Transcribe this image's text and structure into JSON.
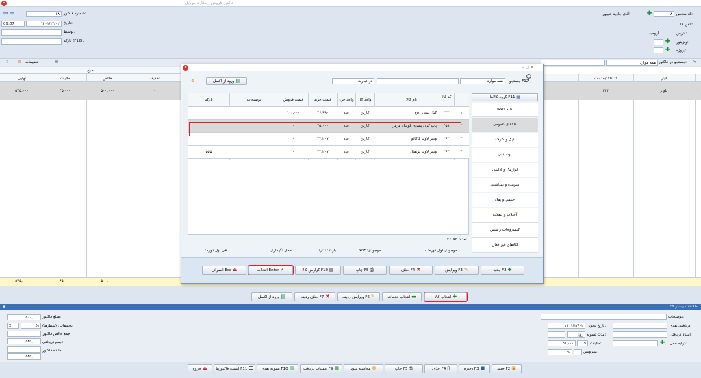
{
  "app": {
    "title": "فاکتور فروش - مغازه موبایل"
  },
  "header": {
    "invoice_no_label": "شماره فاکتور:",
    "invoice_no": "۱۸",
    "date_label": "تاریخ:",
    "date": "۱۴۰۱/۱۲/۰۲",
    "time": "09:07",
    "by_label": "توسط:",
    "barcode_label": "بارکد (F12):",
    "person_code_label": "کد شخص:",
    "person_code": "۸",
    "person_name": "آقای جاوید علیپور",
    "phone_label": "تلفن ها:",
    "address_label": "آدرس:",
    "address": "ارومیه",
    "visitor_label": "ویزیتور:",
    "project_label": "پروژه:",
    "search_label": "جستجو در فاکتور:",
    "search_scope": "همه موارد",
    "settings_label": "تنظیمات"
  },
  "grid": {
    "amount_group": "مبلغ",
    "col_final": "نهایی",
    "col_tax": "مالیات",
    "col_net": "خالص",
    "col_discount": "تخفیف",
    "col_code": "کد کالا /خدمات",
    "col_warehouse": "انبار",
    "row": {
      "final": "۵۴۵,۰۰۰",
      "tax": "۴۵,۰۰۰",
      "net": "۵۰۰,۰۰۰",
      "discount": "۰",
      "code": "۲۲۲",
      "warehouse": "بلوار",
      "idx": "۱"
    },
    "total": {
      "final": "۵۴۵,۰۰۰",
      "tax": "۴۵,۰۰۰",
      "net": "۵۰۰,۰۰۰",
      "discount": "۰",
      "idx": "۱"
    }
  },
  "grid_toolbar": {
    "select_goods": "انتخاب کالا",
    "select_services": "انتخاب خدمات",
    "edit_row": "ویرایش ردیف F6",
    "delete_row": "حذف ردیف F7",
    "import_excel": "ورود از اکسل"
  },
  "dialog": {
    "search_label": "جستجو F12",
    "scope": "همه موارد",
    "phrase": "در عبارت",
    "import_excel": "ورود از اکسل",
    "group_header": "گروه کالاها F11",
    "categories": [
      "کلیه کالاها",
      "کالاهای عمومی",
      "کیک و کلوچه",
      "نوشیدنی",
      "لوازمک و اداسی",
      "شوینده و بهداشتی",
      "چیپس و پفک",
      "آجیلات و تنقلات",
      "کنسروجات و سس",
      "کالاهای غیر فعال"
    ],
    "selected_category": 1,
    "cols": {
      "code": "کد کالا",
      "name": "نام کالا",
      "unit_all": "واحد کل",
      "unit_part": "واحد جزء",
      "buy": "قیمت خرید",
      "sell": "قیمت فروش",
      "desc": "توضیحات",
      "barcode": "بارکد"
    },
    "rows": [
      {
        "idx": "۱",
        "code": "۲۲۲",
        "name": "کیک بنفی ۵۰ع",
        "unit_all": "کارتن",
        "unit_part": "عدد",
        "buy": "۲۶,۹۹۰",
        "sell": "۱۰۰,۰۰۰",
        "desc": "",
        "barcode": ""
      },
      {
        "idx": "۲",
        "code": "۴۵۸",
        "name": "پاپ کرن پسری کوچک مزمز",
        "unit_all": "کارتن",
        "unit_part": "عدد",
        "buy": "۴۵,۰۰۰",
        "sell": "۰",
        "desc": "",
        "barcode": ""
      },
      {
        "idx": "۳",
        "code": "۲۶۲",
        "name": "ویفر لاویتا کاکائو",
        "unit_all": "کارتن",
        "unit_part": "عدد",
        "buy": "۴۲,۲۰۷",
        "sell": "۰",
        "desc": "",
        "barcode": ""
      },
      {
        "idx": "۴",
        "code": "۲۶۳",
        "name": "ویفر لاویتا پرتقال",
        "unit_all": "کارتن",
        "unit_part": "عدد",
        "buy": "۴۲,۲۰۷",
        "sell": "۰",
        "desc": "",
        "barcode": "۵۵۵"
      }
    ],
    "count_label": "تعداد کالا : ۴",
    "stock_first": "موجودی اول دوره: ۰",
    "stock": "موجودی: ۷۵۳",
    "barcode_info": "بارکد: ندارد",
    "storage": "محل نگهداری:",
    "price_first": "فی اول دوره: ۰",
    "btn_new": "جدید F2",
    "btn_edit": "ویرایش F3",
    "btn_delete": "حذف F4",
    "btn_print": "چاپ F5",
    "btn_report": "گزارش کالا F10",
    "btn_select": "انتخاب Enter",
    "btn_cancel": "انصراف Esc"
  },
  "more_info_label": "F8 اطلاعات بیشتر",
  "summary": {
    "invoice_amount_label": "مبلغ فاکتور:",
    "invoice_amount": "۵۰۰,۰۰۰",
    "discounts_label": "تخفیفات: (سطرها)",
    "discounts": "۰",
    "net_total_label": "جمع خالص فاکتور:",
    "net_total": "۵۴۵,۰۰۰",
    "received_total_label": "جمع دریافتی:",
    "remaining_label": "مانده فاکتور:",
    "remaining": "۵۴۵,۰۰۰",
    "desc_label": "توضیحات:",
    "cash_label": "دریافتی نقدی:",
    "delivery_date_label": "تاریخ تحویل:",
    "delivery_date": "۱۴۰۱/۱۲/۰۲",
    "doc_label": "اسناد دریافتی:",
    "settle_label": "مدت تسویه:",
    "settle_unit": "روز",
    "freight_label": "کرایه حمل:",
    "tax_label": "مالیات:",
    "tax_pct": "۹",
    "tax_amount": "۴۵,۰۰۰",
    "service_label": "سرویس:",
    "pct": "%"
  },
  "bottom": {
    "new": "جدید F2",
    "save": "ذخیره F3",
    "delete": "حذف F4",
    "print": "چاپ F5",
    "profit": "محاسبه سود",
    "receive_ops": "عملیات دریافت F9",
    "cash_settle": "تسویه نقدی F10",
    "invoice_list": "لیست فاکتورها F11",
    "exit": "خروج"
  }
}
